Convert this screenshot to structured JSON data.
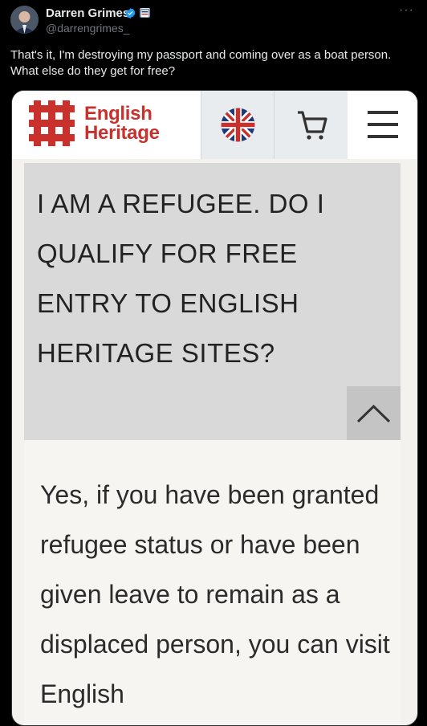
{
  "tweet": {
    "author_name": "Darren Grimes",
    "handle": "@darrengrimes_",
    "more_label": "···",
    "text": "That's it, I'm destroying my passport and coming over as a boat person. What else do they get for free?",
    "colors": {
      "verified": "#1d9bf0",
      "background": "#000000",
      "text": "#e7e9ea",
      "muted": "#71767b"
    }
  },
  "media": {
    "logo": {
      "line1": "English",
      "line2": "Heritage",
      "color": "#c8312c",
      "icon": "english-heritage-logo-icon"
    },
    "header_icons": [
      "uk-flag-icon",
      "cart-icon",
      "menu-icon"
    ],
    "question": "I AM A REFUGEE. DO I QUALIFY FOR FREE ENTRY TO ENGLISH HERITAGE SITES?",
    "toggle_icon": "chevron-up-icon",
    "answer": "Yes, if you have been granted refugee status or have been given leave to remain as a displaced person, you can visit English"
  }
}
